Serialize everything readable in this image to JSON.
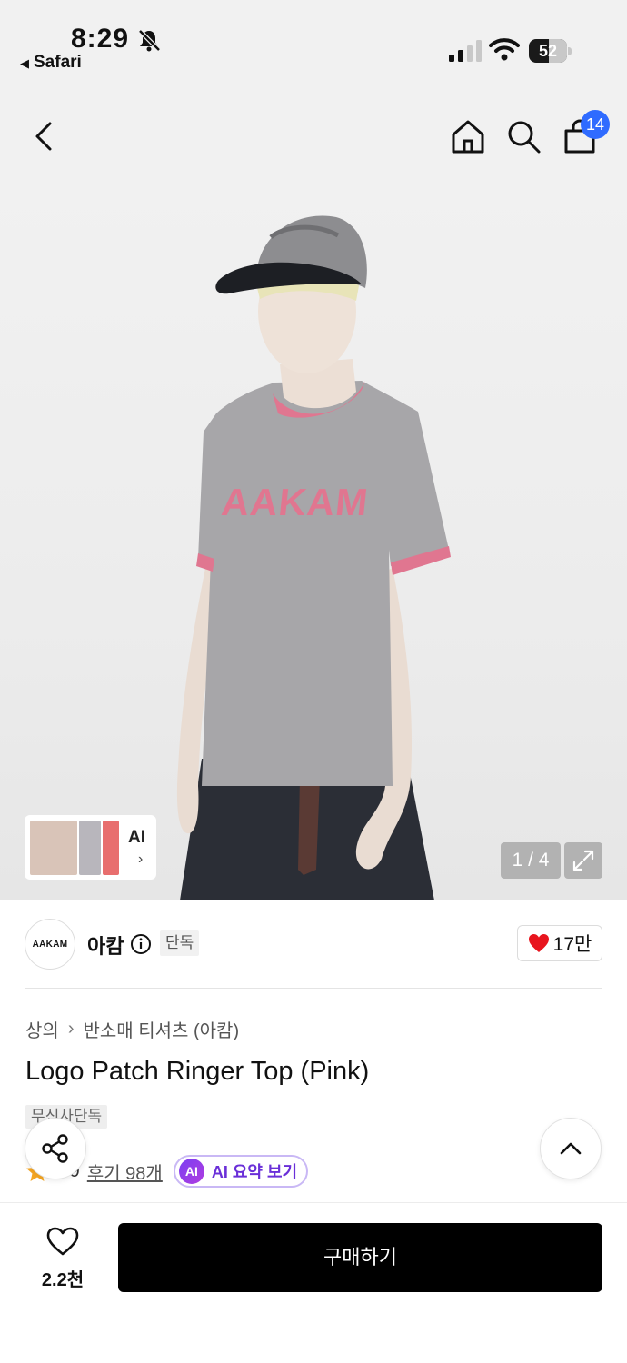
{
  "status_bar": {
    "time": "8:29",
    "back_app": "Safari",
    "battery": "52"
  },
  "nav": {
    "cart_count": "14",
    "icons": [
      "back-icon",
      "home-icon",
      "search-icon",
      "shopping-bag-icon"
    ]
  },
  "gallery": {
    "thumb_ai_label": "AI",
    "thumb_chevron": "›",
    "page_indicator": "1 / 4",
    "logo_text": "AAKAM"
  },
  "brand": {
    "logo_text": "AAKAM",
    "name": "아캄",
    "exclusive_tag": "단독",
    "like_count": "17만"
  },
  "product": {
    "breadcrumb": [
      "상의",
      "반소매 티셔츠 (아캄)"
    ],
    "breadcrumb_sep": "›",
    "title": "Logo Patch Ringer Top (Pink)",
    "store_badge": "무신사단독",
    "rating": "4.9",
    "review_link": "후기 98개",
    "ai_chip": "AI",
    "ai_summary_label": "AI 요약 보기"
  },
  "bottom_bar": {
    "wish_count": "2.2천",
    "buy_label": "구매하기"
  },
  "colors": {
    "accent_blue": "#2f6bff",
    "heart_red": "#e8151e",
    "ai_purple": "#6a2fd8",
    "star_orange": "#f5a623",
    "shirt_pink": "#e07690"
  }
}
